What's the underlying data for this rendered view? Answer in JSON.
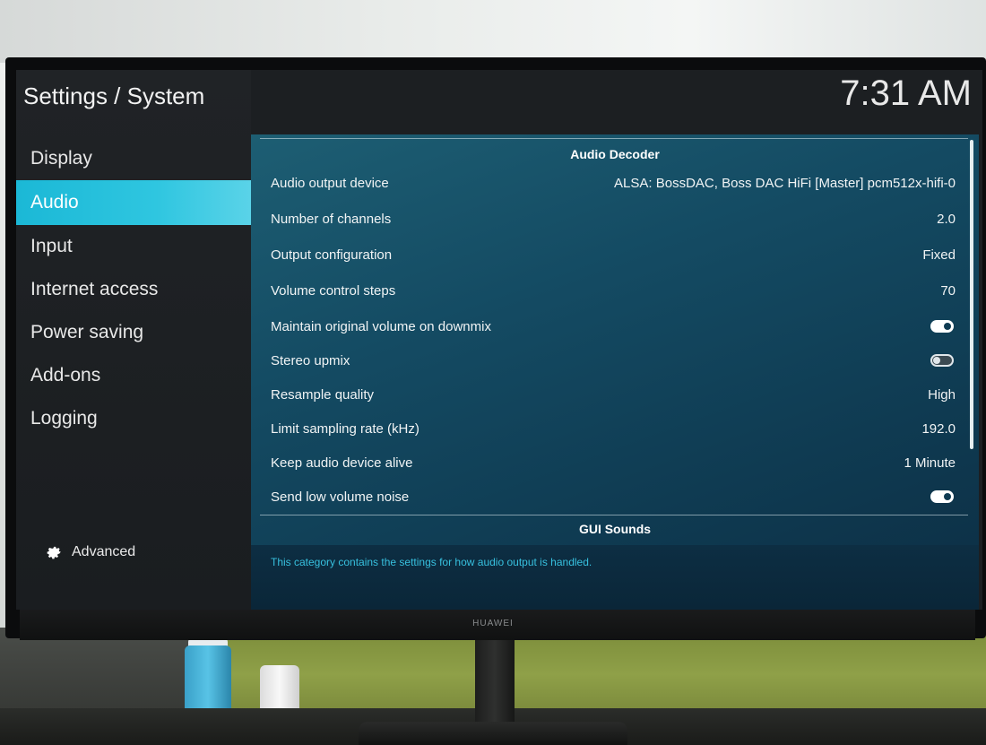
{
  "header": {
    "title": "Settings / System",
    "clock": "7:31 AM"
  },
  "sidebar": {
    "items": [
      {
        "label": "Display",
        "active": false
      },
      {
        "label": "Audio",
        "active": true
      },
      {
        "label": "Input",
        "active": false
      },
      {
        "label": "Internet access",
        "active": false
      },
      {
        "label": "Power saving",
        "active": false
      },
      {
        "label": "Add-ons",
        "active": false
      },
      {
        "label": "Logging",
        "active": false
      }
    ],
    "advanced": {
      "label": "Advanced",
      "icon": "gear-icon"
    }
  },
  "content": {
    "section_audio_decoder": "Audio Decoder",
    "settings": [
      {
        "label": "Audio output device",
        "value": "ALSA: BossDAC, Boss DAC HiFi [Master] pcm512x-hifi-0"
      },
      {
        "label": "Number of channels",
        "value": "2.0"
      },
      {
        "label": "Output configuration",
        "value": "Fixed"
      },
      {
        "label": "Volume control steps",
        "value": "70"
      },
      {
        "label": "Maintain original volume on downmix",
        "toggle": "on"
      },
      {
        "label": "Stereo upmix",
        "toggle": "off"
      },
      {
        "label": "Resample quality",
        "value": "High"
      },
      {
        "label": "Limit sampling rate (kHz)",
        "value": "192.0"
      },
      {
        "label": "Keep audio device alive",
        "value": "1 Minute"
      },
      {
        "label": "Send low volume noise",
        "toggle": "on"
      }
    ],
    "section_gui_sounds": "GUI Sounds",
    "description": "This category contains the settings for how audio output is handled."
  },
  "monitor": {
    "brand": "HUAWEI"
  },
  "colors": {
    "accent": "#1bb8d6",
    "panel": "#144b63",
    "description": "#37c0de"
  }
}
